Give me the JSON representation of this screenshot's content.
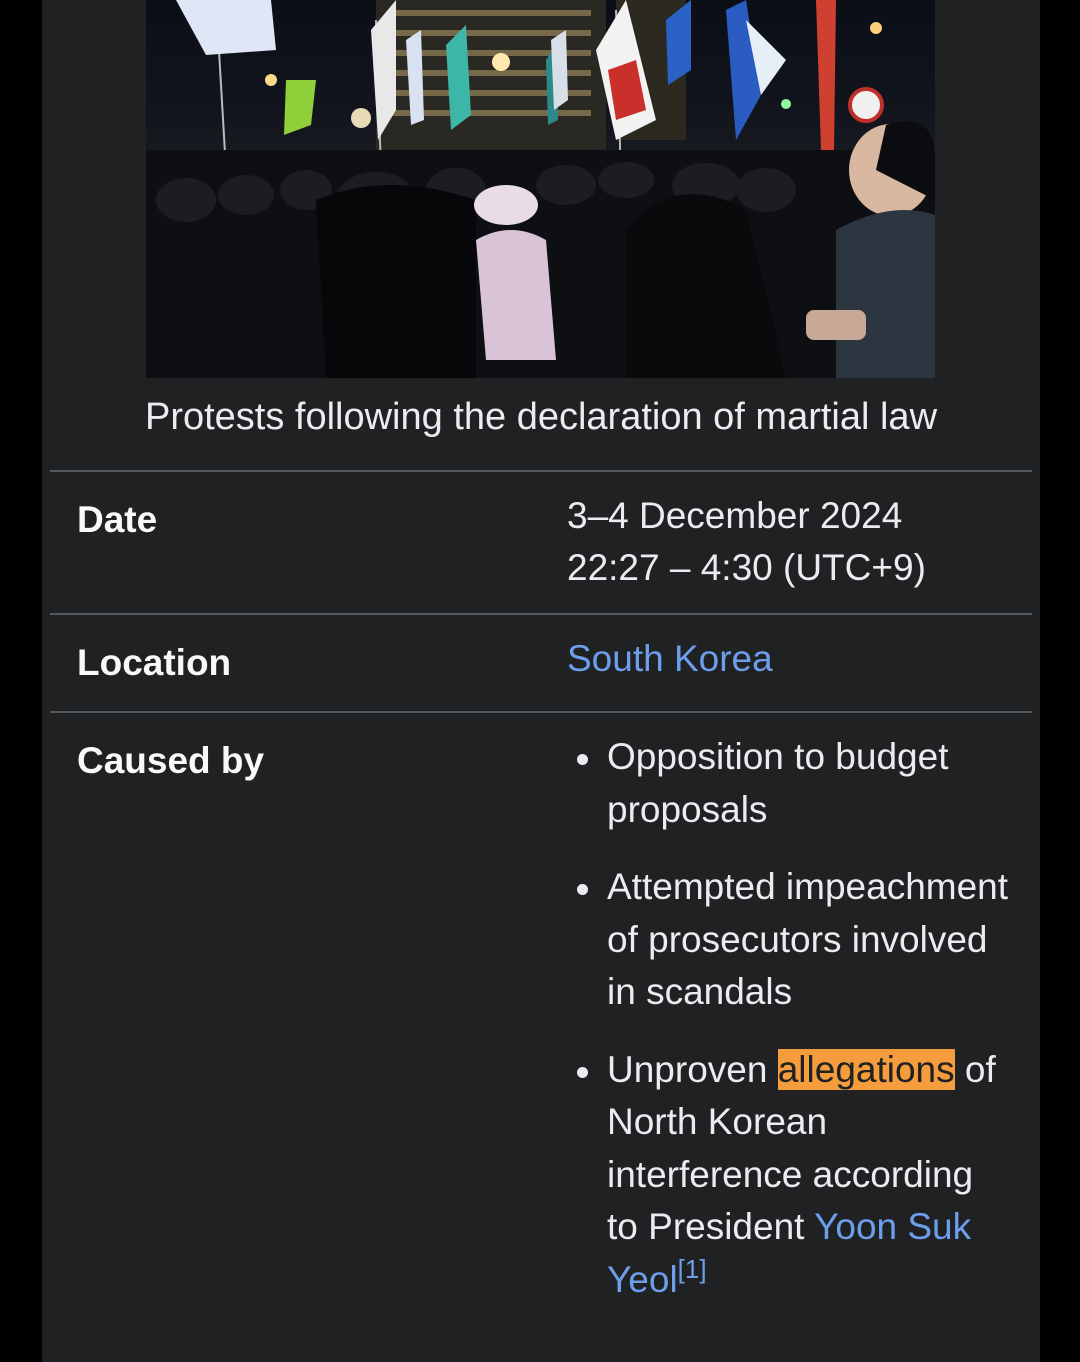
{
  "infobox": {
    "image_alt": "Night protest crowd with flags",
    "caption": "Protests following the declaration of martial law",
    "date": {
      "label": "Date",
      "line1": "3–4 December 2024",
      "line2": "22:27 – 4:30 (UTC+9)"
    },
    "location": {
      "label": "Location",
      "value": "South Korea"
    },
    "caused_by": {
      "label": "Caused by",
      "items": [
        "Opposition to budget proposals",
        "Attempted impeachment of prosecutors involved in scandals"
      ],
      "item3": {
        "prefix": "Unproven",
        "highlight": "allegations",
        "middle": "of North Korean interference according to President",
        "link": "Yoon Suk Yeol",
        "ref": "[1]"
      }
    }
  },
  "colors": {
    "panel_bg": "#202122",
    "page_bg": "#000000",
    "link": "#6d9eeb",
    "highlight": "#f59d3d",
    "rule": "#54595d"
  }
}
